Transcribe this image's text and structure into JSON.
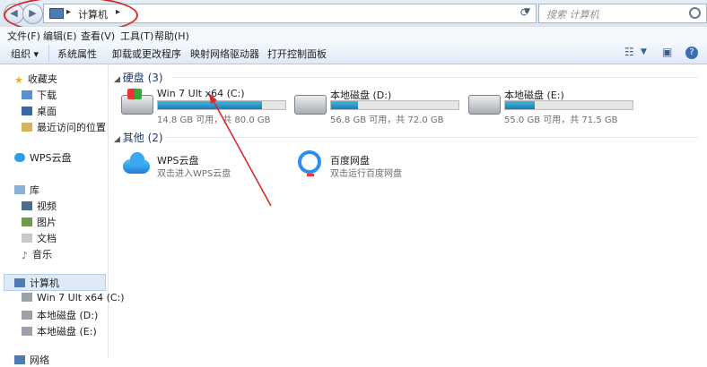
{
  "address": {
    "path": "计算机",
    "search_placeholder": "搜索 计算机"
  },
  "menu": [
    "文件(F)",
    "编辑(E)",
    "查看(V)",
    "工具(T)",
    "帮助(H)"
  ],
  "toolbar": [
    "组织 ▾",
    "系统属性",
    "卸载或更改程序",
    "映射网络驱动器",
    "打开控制面板"
  ],
  "sidebar": {
    "favorites": "收藏夹",
    "fav_items": [
      "下载",
      "桌面",
      "最近访问的位置"
    ],
    "wps": "WPS云盘",
    "library": "库",
    "lib_items": [
      "视频",
      "图片",
      "文档",
      "音乐"
    ],
    "computer": "计算机",
    "drives": [
      "Win 7 Ult x64 (C:)",
      "本地磁盘 (D:)",
      "本地磁盘 (E:)"
    ],
    "cut": "网络"
  },
  "groups": {
    "hard": "硬盘 (3)",
    "other": "其他 (2)"
  },
  "drives": [
    {
      "name": "Win 7 Ult x64 (C:)",
      "free": "14.8 GB 可用，共 80.0 GB",
      "used_fraction": 0.815
    },
    {
      "name": "本地磁盘 (D:)",
      "free": "56.8 GB 可用，共 72.0 GB",
      "used_fraction": 0.21
    },
    {
      "name": "本地磁盘 (E:)",
      "free": "55.0 GB 可用，共 71.5 GB",
      "used_fraction": 0.23
    }
  ],
  "others": [
    {
      "name": "WPS云盘",
      "desc": "双击进入WPS云盘"
    },
    {
      "name": "百度网盘",
      "desc": "双击运行百度网盘"
    }
  ],
  "colors": {
    "annotation": "#d9292a",
    "bar": "#1b7fb3",
    "group": "#1e3a6e"
  }
}
